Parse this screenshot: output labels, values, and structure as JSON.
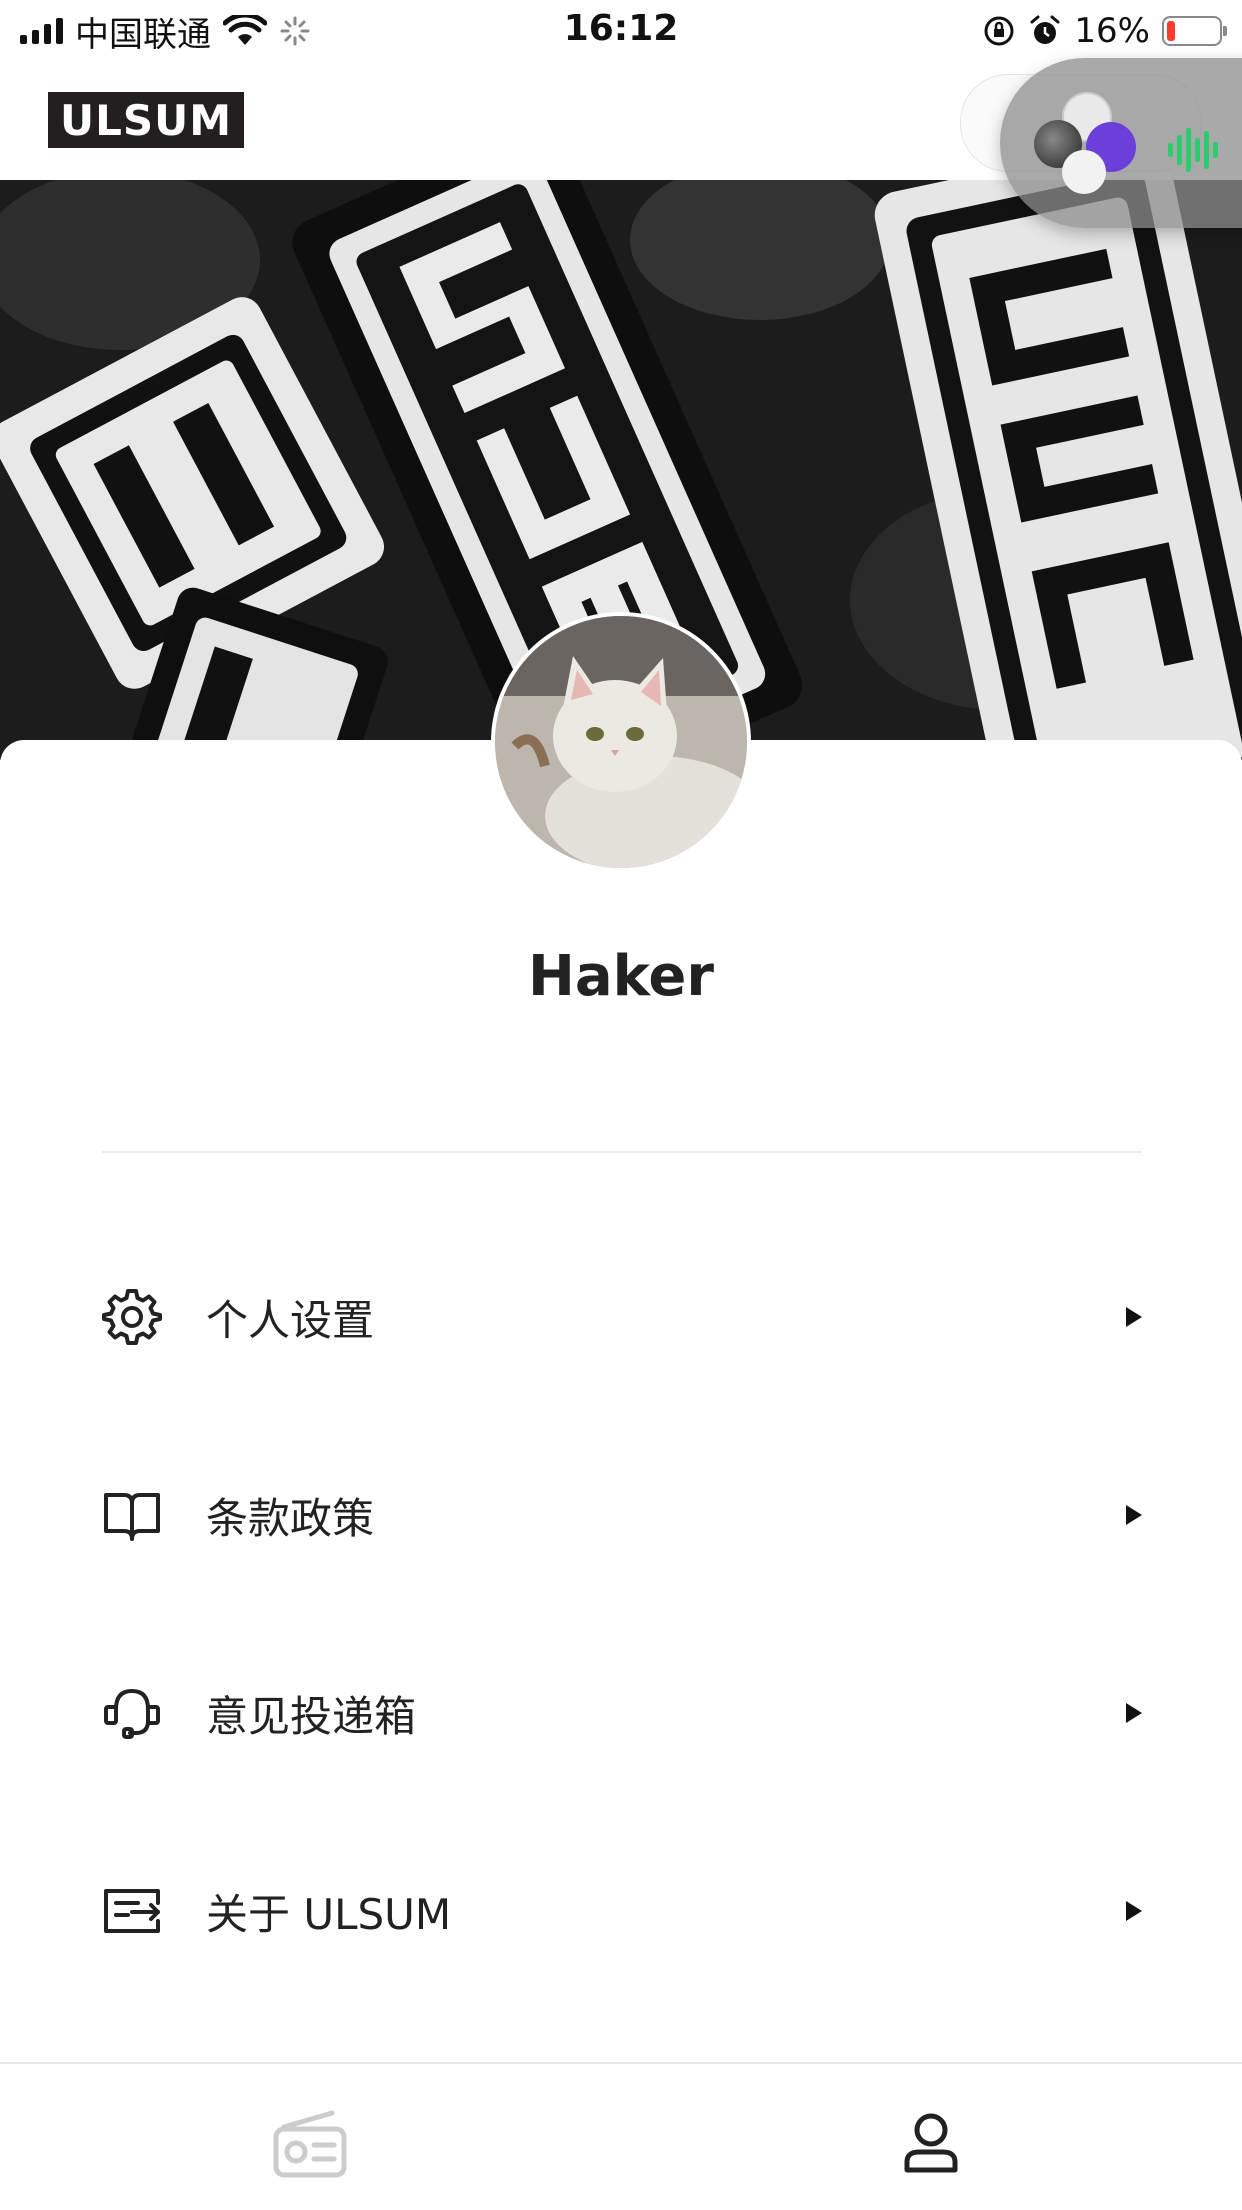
{
  "status_bar": {
    "carrier": "中国联通",
    "time": "16:12",
    "battery_percent": "16%",
    "battery_level": 0.16,
    "battery_color": "#ff3b30"
  },
  "header": {
    "logo_text": "ULSUM"
  },
  "floating_bubble": {
    "icons": [
      "link-icon",
      "photo-thumbnail",
      "app-icon-purple",
      "audio-wave-icon"
    ]
  },
  "profile": {
    "username": "Haker",
    "avatar_description_icon": "cat-avatar"
  },
  "menu": [
    {
      "id": "personal-settings",
      "label": "个人设置",
      "icon": "gear-icon"
    },
    {
      "id": "terms-policy",
      "label": "条款政策",
      "icon": "book-icon"
    },
    {
      "id": "feedback-box",
      "label": "意见投递箱",
      "icon": "headset-icon"
    },
    {
      "id": "about-ulsum",
      "label": "关于 ULSUM",
      "icon": "info-card-icon"
    }
  ],
  "tab_bar": {
    "tabs": [
      {
        "id": "radio",
        "icon": "radio-icon",
        "active": false
      },
      {
        "id": "profile",
        "icon": "user-icon",
        "active": true
      }
    ]
  },
  "colors": {
    "accent": "#222222",
    "inactive_tab": "#cccccc",
    "divider": "#ececec"
  }
}
